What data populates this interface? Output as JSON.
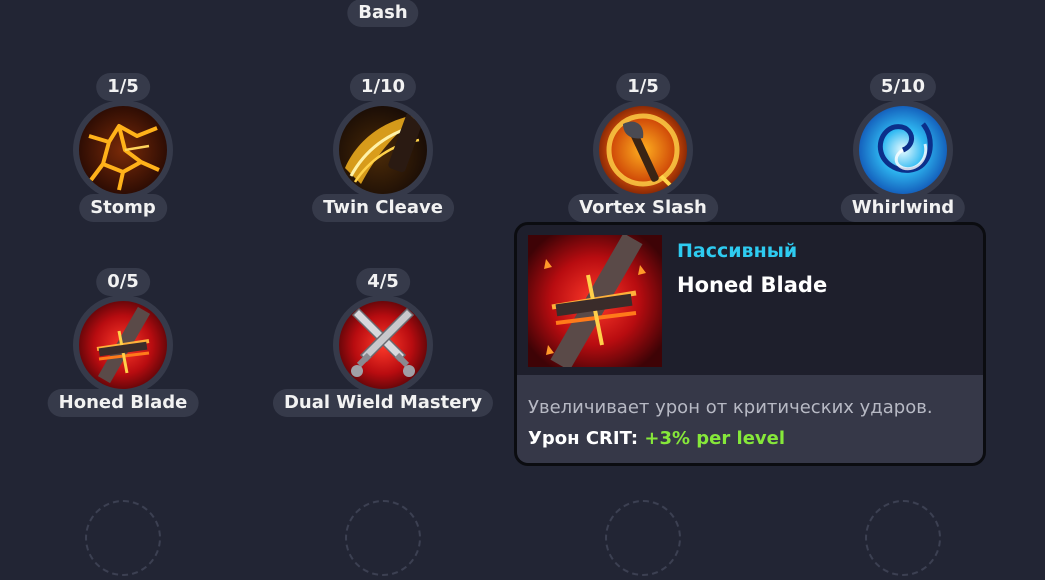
{
  "top_skill": {
    "label": "Bash"
  },
  "skills": [
    {
      "name": "Stomp",
      "level": "1/5",
      "icon": "lava-crack-icon"
    },
    {
      "name": "Twin Cleave",
      "level": "1/10",
      "icon": "golden-slash-icon"
    },
    {
      "name": "Vortex Slash",
      "level": "1/5",
      "icon": "fire-axe-icon"
    },
    {
      "name": "Whirlwind",
      "level": "5/10",
      "icon": "blue-vortex-icon"
    },
    {
      "name": "Honed Blade",
      "level": "0/5",
      "icon": "crossed-blade-icon"
    },
    {
      "name": "Dual Wield Mastery",
      "level": "4/5",
      "icon": "crossed-daggers-icon"
    }
  ],
  "tooltip": {
    "type": "Пассивный",
    "name": "Honed Blade",
    "description": "Увеличивает урон от критических ударов.",
    "stat_label": "Урон CRIT:",
    "stat_value": "+3% per level",
    "icon": "crossed-blade-icon"
  },
  "colors": {
    "background": "#222534",
    "pill": "#363a4a",
    "type_text": "#2ecbf0",
    "stat_value": "#86e83a"
  }
}
